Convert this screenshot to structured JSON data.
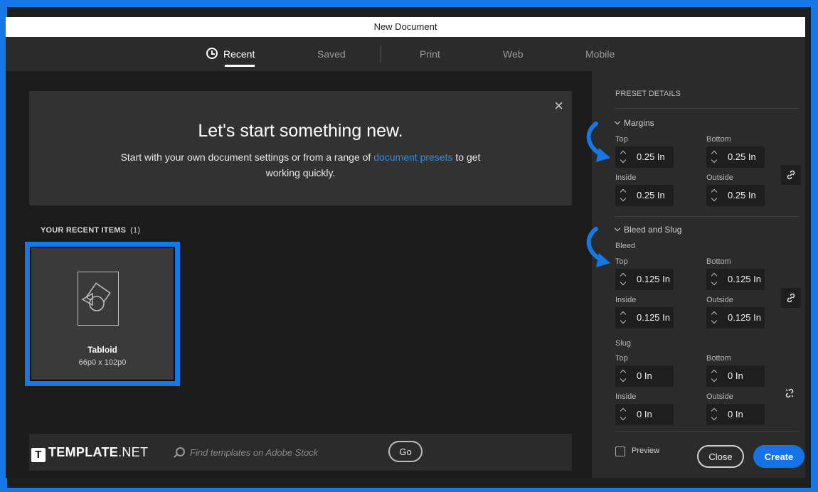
{
  "window": {
    "title": "New Document"
  },
  "tabs": [
    {
      "label": "Recent",
      "active": true
    },
    {
      "label": "Saved"
    },
    {
      "label": "Print"
    },
    {
      "label": "Web"
    },
    {
      "label": "Mobile"
    }
  ],
  "welcome": {
    "title": "Let's start something new.",
    "text_before": "Start with your own document settings or from a range of ",
    "link": "document presets",
    "text_after": " to get working quickly.",
    "close_icon": "×"
  },
  "recent": {
    "heading": "YOUR RECENT ITEMS",
    "count": "(1)",
    "items": [
      {
        "name": "Tabloid",
        "size": "66p0 x 102p0"
      }
    ]
  },
  "search": {
    "placeholder": "Find templates on Adobe Stock",
    "go_label": "Go"
  },
  "brand": {
    "t": "T",
    "name": "TEMPLATE",
    "suffix": ".NET"
  },
  "panel": {
    "heading": "PRESET DETAILS",
    "margins": {
      "label": "Margins",
      "top_label": "Top",
      "bottom_label": "Bottom",
      "inside_label": "Inside",
      "outside_label": "Outside",
      "top": "0.25 In",
      "bottom": "0.25 In",
      "inside": "0.25 In",
      "outside": "0.25 In"
    },
    "bleed_slug": {
      "label": "Bleed and Slug",
      "bleed_label": "Bleed",
      "slug_label": "Slug",
      "top_label": "Top",
      "bottom_label": "Bottom",
      "inside_label": "Inside",
      "outside_label": "Outside",
      "bleed": {
        "top": "0.125 In",
        "bottom": "0.125 In",
        "inside": "0.125 In",
        "outside": "0.125 In"
      },
      "slug": {
        "top": "0 In",
        "bottom": "0 In",
        "inside": "0 In",
        "outside": "0 In"
      }
    },
    "preview_label": "Preview",
    "close_label": "Close",
    "create_label": "Create"
  },
  "colors": {
    "accent": "#1478e6",
    "link": "#2d8ceb",
    "panel": "#2b2b2b"
  }
}
